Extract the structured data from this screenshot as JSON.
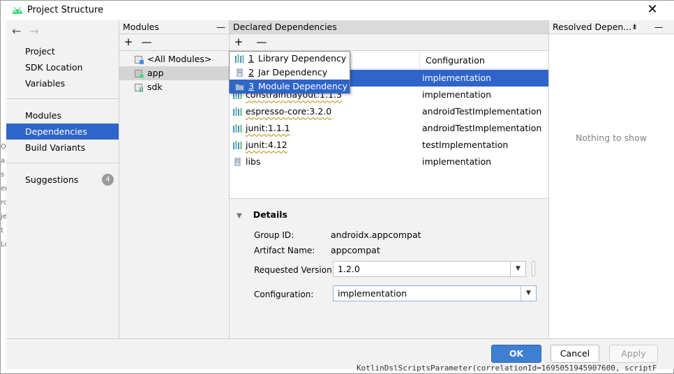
{
  "window": {
    "title": "Project Structure",
    "close_icon": "close-icon",
    "app_icon": "android-icon"
  },
  "nav": {
    "back_icon": "arrow-left-icon",
    "forward_icon": "arrow-right-icon",
    "items": [
      {
        "label": "Project"
      },
      {
        "label": "SDK Location"
      },
      {
        "label": "Variables"
      },
      {
        "label": "Modules"
      },
      {
        "label": "Dependencies",
        "selected": true
      },
      {
        "label": "Build Variants"
      },
      {
        "label": "Suggestions",
        "badge": "4"
      }
    ]
  },
  "edge_text": [
    "Or",
    "a",
    "s",
    "er",
    "ro",
    "je",
    "t",
    "Lo",
    "ut",
    "es"
  ],
  "modules": {
    "header": "Modules",
    "collapse": "—",
    "add": "+",
    "remove": "—",
    "items": [
      {
        "label": "<All Modules>",
        "icon": "all-modules-icon"
      },
      {
        "label": "app",
        "icon": "app-module-icon",
        "selected": true
      },
      {
        "label": "sdk",
        "icon": "library-module-icon"
      }
    ]
  },
  "declared": {
    "header": "Declared Dependencies",
    "add": "+",
    "remove": "—",
    "config_header": "Configuration",
    "rows": [
      {
        "name": "",
        "config": "implementation",
        "selected": true
      },
      {
        "name": "constraintlayout:1.1.3",
        "config": "implementation"
      },
      {
        "name": "espresso-core:3.2.0",
        "config": "androidTestImplementation"
      },
      {
        "name": "junit:1.1.1",
        "config": "androidTestImplementation"
      },
      {
        "name": "junit:4.12",
        "config": "testImplementation"
      },
      {
        "name": "libs",
        "config": "implementation"
      }
    ]
  },
  "popup": {
    "items": [
      {
        "num": "1",
        "label": "Library Dependency",
        "icon": "library-icon"
      },
      {
        "num": "2",
        "label": "Jar Dependency",
        "icon": "jar-icon"
      },
      {
        "num": "3",
        "label": "Module Dependency",
        "icon": "module-icon",
        "selected": true
      }
    ]
  },
  "details": {
    "title": "Details",
    "group_id_label": "Group ID:",
    "group_id": "androidx.appcompat",
    "artifact_label": "Artifact Name:",
    "artifact": "appcompat",
    "version_label": "Requested Version:",
    "version": "1.2.0",
    "config_label": "Configuration:",
    "config": "implementation"
  },
  "resolved": {
    "header": "Resolved Depen...",
    "empty": "Nothing to show",
    "collapse": "—"
  },
  "buttons": {
    "ok": "OK",
    "cancel": "Cancel",
    "apply": "Apply"
  },
  "background_text": "KotlinDslScriptsParameter(correlationId=1695051945907600, scriptF"
}
